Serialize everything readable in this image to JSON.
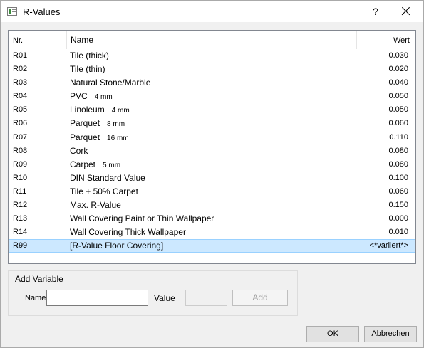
{
  "window": {
    "title": "R-Values",
    "help_label": "?"
  },
  "table": {
    "headers": {
      "nr": "Nr.",
      "name": "Name",
      "wert": "Wert"
    },
    "rows": [
      {
        "nr": "R01",
        "name": "Tile (thick)",
        "sub": "",
        "wert": "0.030"
      },
      {
        "nr": "R02",
        "name": "Tile (thin)",
        "sub": "",
        "wert": "0.020"
      },
      {
        "nr": "R03",
        "name": "Natural Stone/Marble",
        "sub": "",
        "wert": "0.040"
      },
      {
        "nr": "R04",
        "name": "PVC",
        "sub": "4 mm",
        "wert": "0.050"
      },
      {
        "nr": "R05",
        "name": "Linoleum",
        "sub": "4 mm",
        "wert": "0.050"
      },
      {
        "nr": "R06",
        "name": "Parquet",
        "sub": "8 mm",
        "wert": "0.060"
      },
      {
        "nr": "R07",
        "name": "Parquet",
        "sub": "16 mm",
        "wert": "0.110"
      },
      {
        "nr": "R08",
        "name": "Cork",
        "sub": "",
        "wert": "0.080"
      },
      {
        "nr": "R09",
        "name": "Carpet",
        "sub": "5 mm",
        "wert": "0.080"
      },
      {
        "nr": "R10",
        "name": "DIN Standard Value",
        "sub": "",
        "wert": "0.100"
      },
      {
        "nr": "R11",
        "name": "Tile + 50% Carpet",
        "sub": "",
        "wert": "0.060"
      },
      {
        "nr": "R12",
        "name": "Max. R-Value",
        "sub": "",
        "wert": "0.150"
      },
      {
        "nr": "R13",
        "name": "Wall Covering Paint or Thin Wallpaper",
        "sub": "",
        "wert": "0.000"
      },
      {
        "nr": "R14",
        "name": "Wall Covering Thick Wallpaper",
        "sub": "",
        "wert": "0.010"
      },
      {
        "nr": "R99",
        "name": "[R-Value Floor Covering]",
        "sub": "",
        "wert": "<*variiert*>",
        "selected": true
      }
    ]
  },
  "add_variable": {
    "title": "Add Variable",
    "name_label": "Name",
    "name_value": "",
    "value_label": "Value",
    "value_value": "",
    "add_label": "Add"
  },
  "buttons": {
    "ok": "OK",
    "cancel": "Abbrechen"
  },
  "colors": {
    "selection_bg": "#cce8ff",
    "selection_border": "#99d1ff",
    "dialog_bg": "#f0f0f0"
  }
}
